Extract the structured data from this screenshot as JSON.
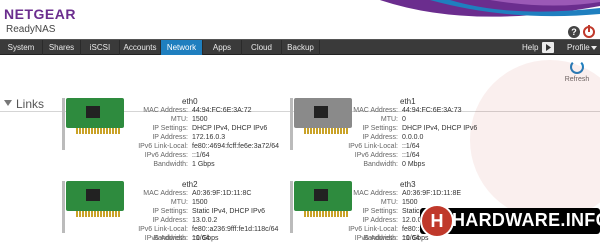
{
  "header": {
    "brand": "NETGEAR",
    "sub_brand": "ReadyNAS",
    "help_glyph": "?"
  },
  "tabs": [
    {
      "label": "System"
    },
    {
      "label": "Shares"
    },
    {
      "label": "iSCSI"
    },
    {
      "label": "Accounts"
    },
    {
      "label": "Network",
      "active": true
    },
    {
      "label": "Apps"
    },
    {
      "label": "Cloud"
    },
    {
      "label": "Backup"
    }
  ],
  "right_controls": {
    "help_label": "Help",
    "profile_label": "Profile"
  },
  "refresh": {
    "label": "Refresh"
  },
  "section": {
    "title": "Links"
  },
  "row_labels": {
    "mac": "MAC Address:",
    "mtu": "MTU:",
    "ip_settings": "IP Settings:",
    "ip_address": "IP Address:",
    "ipv6_link_local": "IPv6 Link-Local:",
    "ipv6_address": "IPv6 Address:",
    "bandwidth": "Bandwidth:"
  },
  "interfaces": [
    {
      "name": "eth0",
      "state": "active",
      "mac": "44:94:FC:6E:3A:72",
      "mtu": "1500",
      "ip_settings": "DHCP IPv4, DHCP IPv6",
      "ip_address": "172.16.0.3",
      "ipv6_link_local": "fe80::4694:fcff:fe6e:3a72/64",
      "ipv6_address": "::1/64",
      "bandwidth": "1 Gbps"
    },
    {
      "name": "eth1",
      "state": "inactive",
      "mac": "44:94:FC:6E:3A:73",
      "mtu": "0",
      "ip_settings": "DHCP IPv4, DHCP IPv6",
      "ip_address": "0.0.0.0",
      "ipv6_link_local": "::1/64",
      "ipv6_address": "::1/64",
      "bandwidth": "0 Mbps"
    },
    {
      "name": "eth2",
      "state": "active",
      "mac": "A0:36:9F:1D:11:8C",
      "mtu": "1500",
      "ip_settings": "Static IPv4, DHCP IPv6",
      "ip_address": "13.0.0.2",
      "ipv6_link_local": "fe80::a236:9fff:fe1d:118c/64",
      "ipv6_address": "::1/64",
      "bandwidth": "10 Gbps"
    },
    {
      "name": "eth3",
      "state": "active",
      "mac": "A0:36:9F:1D:11:8E",
      "mtu": "1500",
      "ip_settings": "Static IPv4, DHCP IPv6",
      "ip_address": "12.0.0.2",
      "ipv6_link_local": "fe80::a236:9fff:fe1d:118e/64",
      "ipv6_address": "::1/64",
      "bandwidth": "10 Gbps"
    }
  ],
  "watermark": {
    "text": "HARDWARE.INFO",
    "logo_letter": "H"
  },
  "colors": {
    "brand": "#6b2d8e",
    "active_tab": "#1f7fbf",
    "tabbar": "#3a3a3a",
    "nic_active": "#2e8b3e",
    "nic_inactive": "#8a8a8a",
    "watermark_red": "#c0392b"
  }
}
